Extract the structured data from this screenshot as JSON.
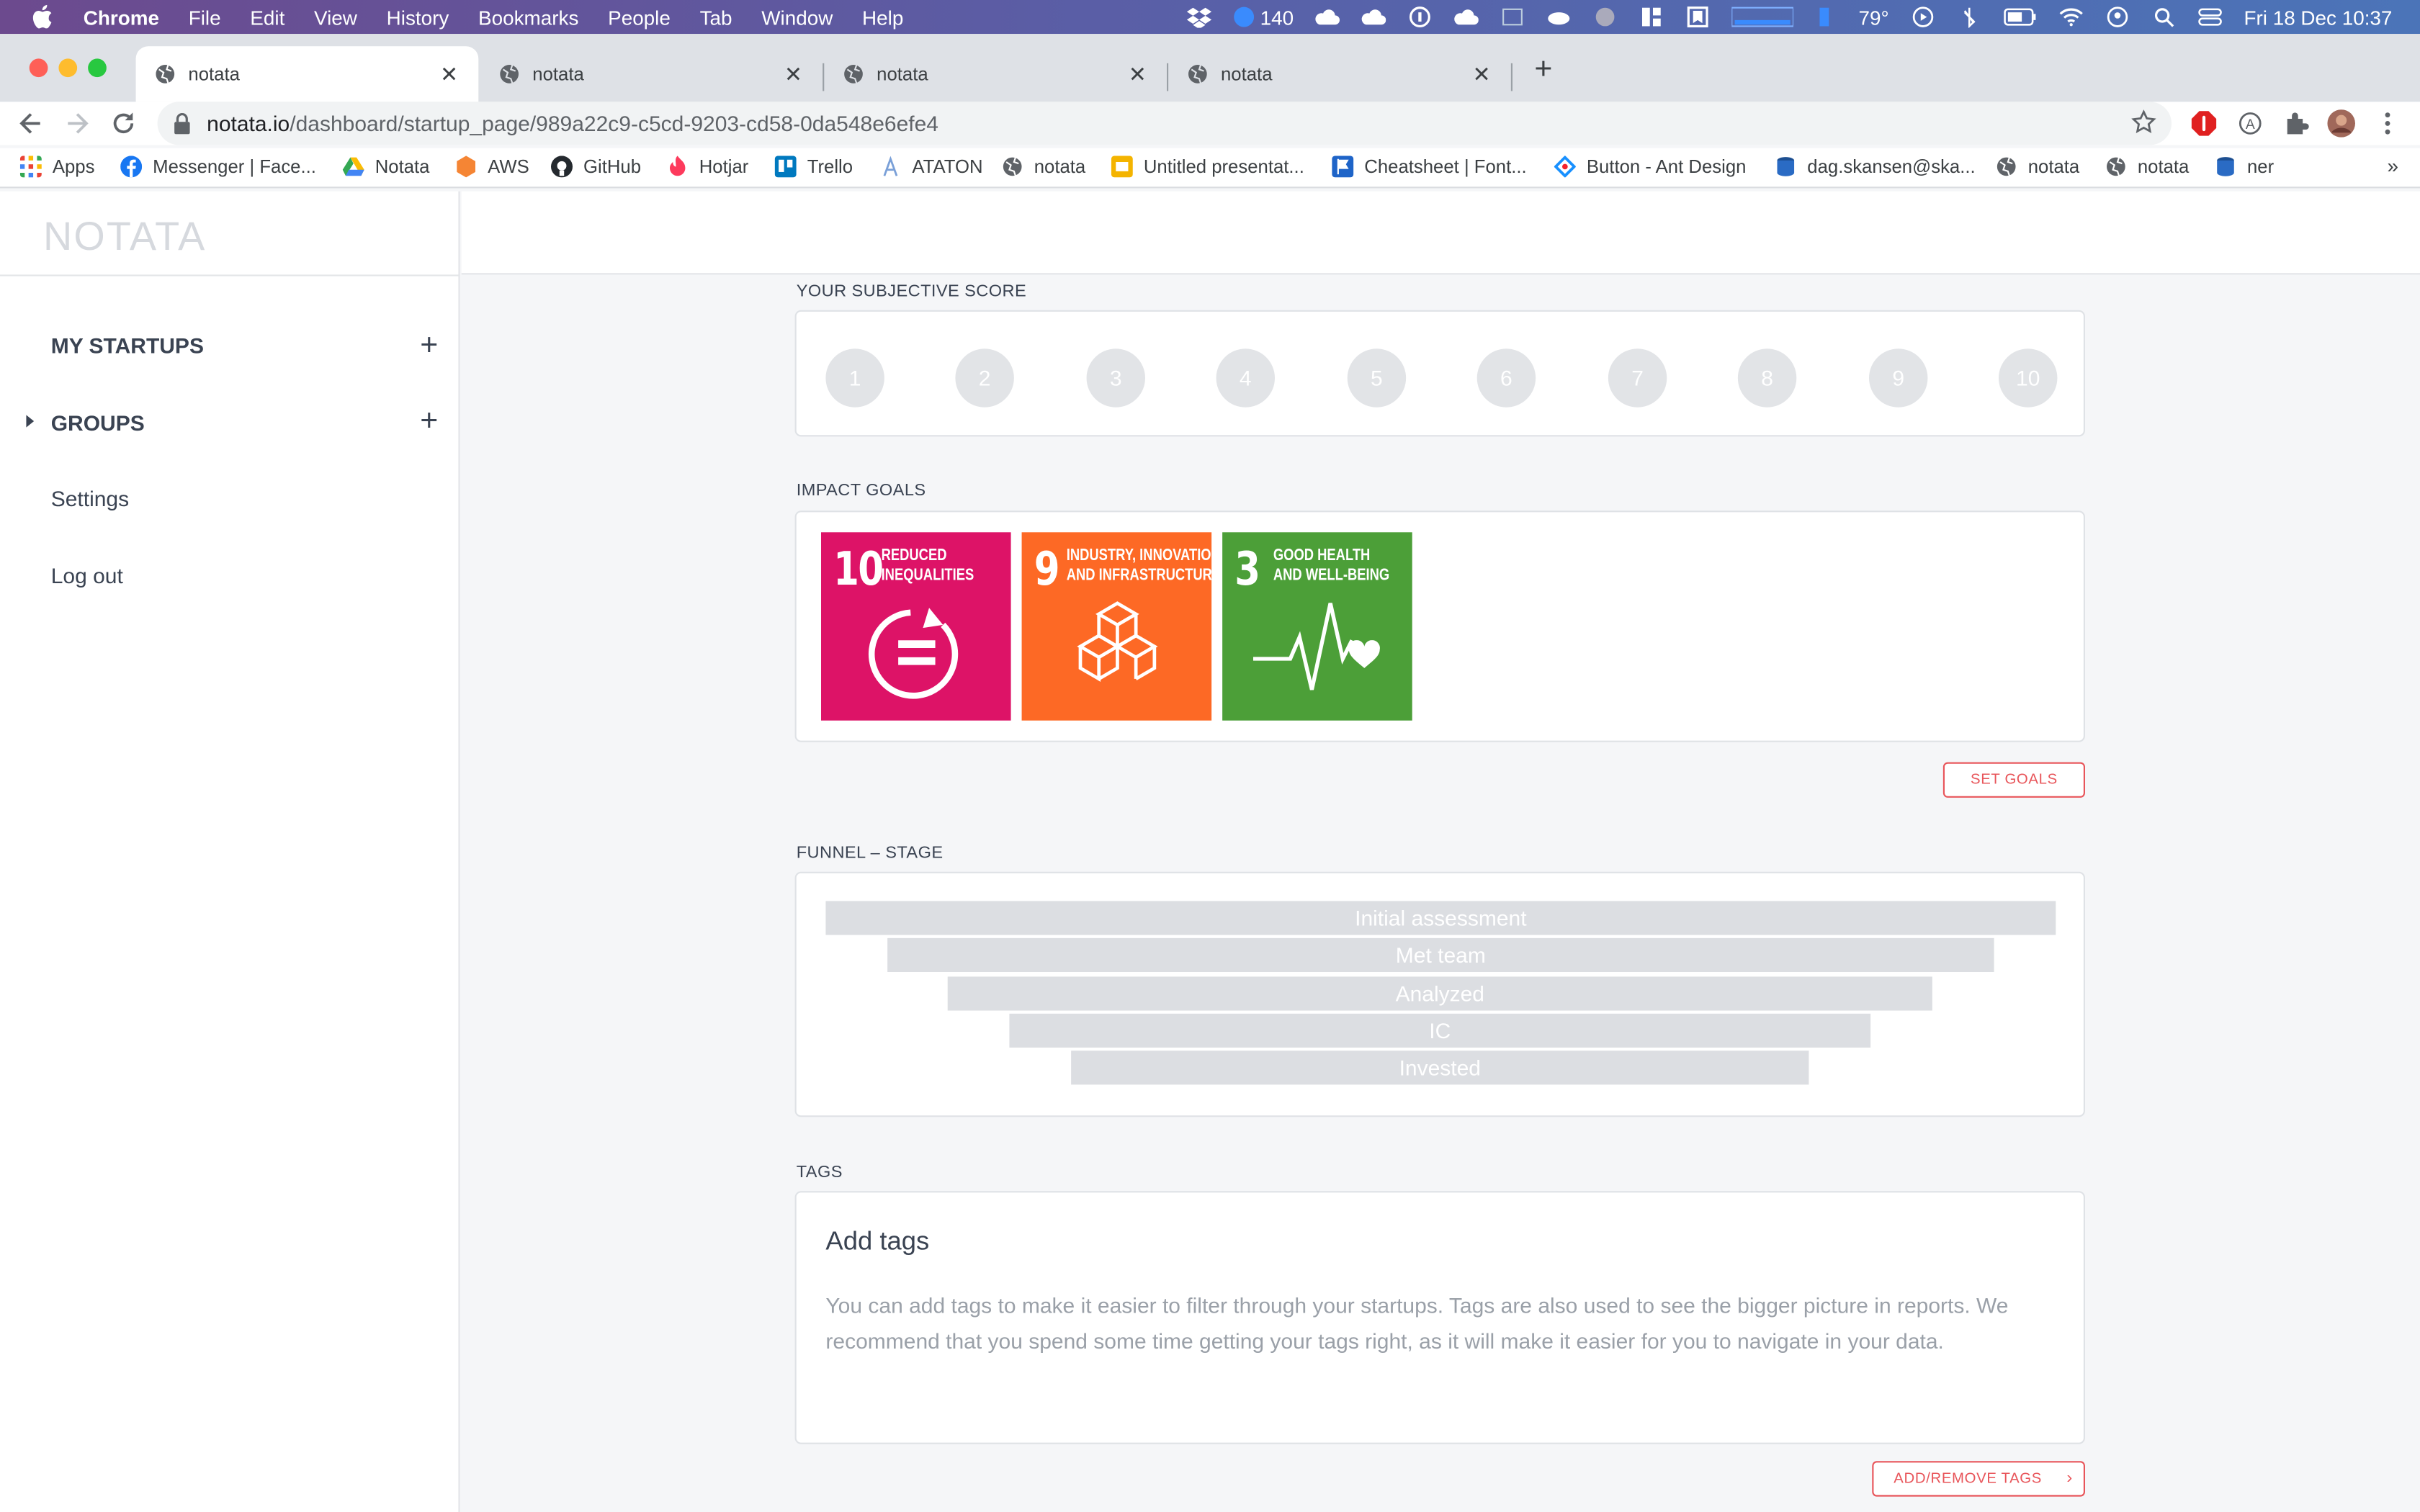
{
  "menubar": {
    "app": "Chrome",
    "items": [
      "File",
      "Edit",
      "View",
      "History",
      "Bookmarks",
      "People",
      "Tab",
      "Window",
      "Help"
    ],
    "status": {
      "badge_count": "140",
      "temperature": "79°",
      "datetime": "Fri 18 Dec  10:37"
    }
  },
  "tabs": [
    {
      "title": "notata",
      "active": true
    },
    {
      "title": "notata",
      "active": false
    },
    {
      "title": "notata",
      "active": false
    },
    {
      "title": "notata",
      "active": false
    }
  ],
  "address": {
    "host": "notata.io",
    "path": "/dashboard/startup_page/989a22c9-c5cd-9203-cd58-0da548e6efe4"
  },
  "bookmarks": [
    {
      "label": "Apps",
      "icon": "apps-grid-icon"
    },
    {
      "label": "Messenger | Face...",
      "icon": "facebook-icon"
    },
    {
      "label": "Notata",
      "icon": "google-drive-icon"
    },
    {
      "label": "AWS",
      "icon": "aws-icon"
    },
    {
      "label": "GitHub",
      "icon": "github-icon"
    },
    {
      "label": "Hotjar",
      "icon": "hotjar-icon"
    },
    {
      "label": "Trello",
      "icon": "trello-icon"
    },
    {
      "label": "ATATON",
      "icon": "ataton-icon"
    },
    {
      "label": "notata",
      "icon": "globe-icon"
    },
    {
      "label": "Untitled presentat...",
      "icon": "slides-icon"
    },
    {
      "label": "Cheatsheet | Font...",
      "icon": "flag-icon"
    },
    {
      "label": "Button - Ant Design",
      "icon": "ant-design-icon"
    },
    {
      "label": "dag.skansen@ska...",
      "icon": "database-icon"
    },
    {
      "label": "notata",
      "icon": "globe-icon"
    },
    {
      "label": "notata",
      "icon": "globe-icon"
    },
    {
      "label": "ner",
      "icon": "database-icon"
    }
  ],
  "bookmarks_more": "»",
  "sidebar": {
    "logo": "NOTATA",
    "my_startups": "MY STARTUPS",
    "groups": "GROUPS",
    "settings": "Settings",
    "logout": "Log out"
  },
  "subjective_score": {
    "title": "YOUR SUBJECTIVE SCORE",
    "values": [
      "1",
      "2",
      "3",
      "4",
      "5",
      "6",
      "7",
      "8",
      "9",
      "10"
    ]
  },
  "impact_goals": {
    "title": "IMPACT GOALS",
    "goals": [
      {
        "number": "10",
        "line1": "REDUCED",
        "line2": "INEQUALITIES",
        "color": "#dd1367"
      },
      {
        "number": "9",
        "line1": "INDUSTRY, INNOVATION",
        "line2": "AND INFRASTRUCTURE",
        "color": "#fd6925"
      },
      {
        "number": "3",
        "line1": "GOOD HEALTH",
        "line2": "AND WELL-BEING",
        "color": "#4c9f38"
      }
    ],
    "button": "SET GOALS"
  },
  "funnel": {
    "title": "FUNNEL – STAGE",
    "stages": [
      "Initial assessment",
      "Met team",
      "Analyzed",
      "IC",
      "Invested"
    ]
  },
  "tags": {
    "title": "TAGS",
    "heading": "Add tags",
    "description": "You can add tags to make it easier to filter through your startups. Tags are also used to see the bigger picture in reports. We recommend that you spend some time getting your tags right, as it will make it easier for you to navigate in your data.",
    "button": "ADD/REMOVE TAGS"
  },
  "colors": {
    "accent": "#e8555a",
    "text": "#3a4352",
    "muted": "#9aa0a8"
  }
}
